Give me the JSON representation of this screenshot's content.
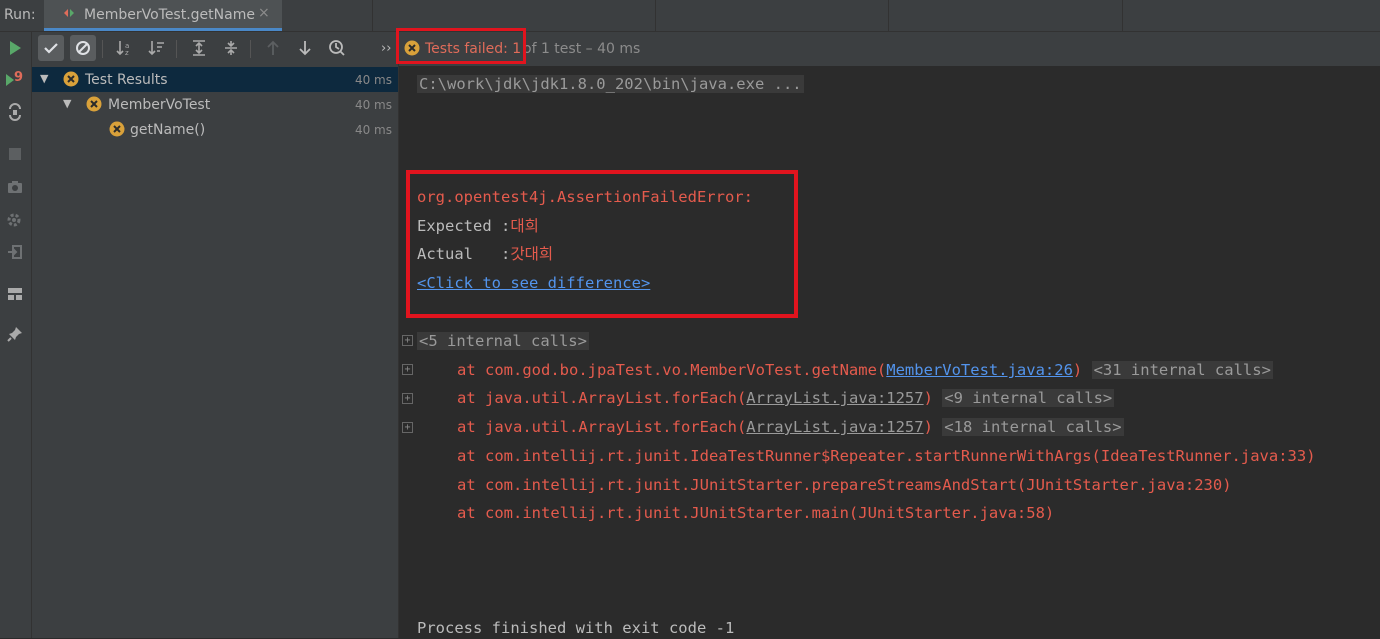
{
  "topbar": {
    "run_label": "Run:",
    "tab_title": "MemberVoTest.getName",
    "tab_close": "×"
  },
  "leftbar": {
    "icons": [
      "run-icon",
      "rerun-failed-icon",
      "toggle-auto-test-icon",
      "stop-icon",
      "camera-icon",
      "settings-icon",
      "exit-icon",
      "layout-icon",
      "pin-icon"
    ],
    "rerun_badge": "9"
  },
  "toolbar": {
    "icons": [
      "show-passed-icon",
      "show-ignored-icon",
      "sort-alpha-icon",
      "sort-duration-icon",
      "expand-all-icon",
      "collapse-all-icon",
      "previous-failed-icon",
      "next-failed-icon",
      "history-icon"
    ],
    "more": "››"
  },
  "tree": {
    "rows": [
      {
        "label": "Test Results",
        "time": "40 ms"
      },
      {
        "label": "MemberVoTest",
        "time": "40 ms"
      },
      {
        "label": "getName()",
        "time": "40 ms"
      }
    ]
  },
  "status": {
    "failed": "Tests failed: 1",
    "rest": "of 1 test – 40 ms"
  },
  "console": {
    "command": "C:\\work\\jdk\\jdk1.8.0_202\\bin\\java.exe ...",
    "error_class": "org.opentest4j.AssertionFailedError:",
    "expected_label": "Expected :",
    "expected_value": "대희",
    "actual_label": "Actual   :",
    "actual_value": "갓대희",
    "diff_link": "<Click to see difference>",
    "internal_5": "<5 internal calls>",
    "trace": [
      {
        "prefix": "at com.god.bo.jpaTest.vo.MemberVoTest.getName(",
        "link": "MemberVoTest.java:26",
        "suffix": ")",
        "internal": "<31 internal calls>"
      },
      {
        "prefix": "at java.util.ArrayList.forEach(",
        "link": "ArrayList.java:1257",
        "suffix": ")",
        "internal": "<9 internal calls>"
      },
      {
        "prefix": "at java.util.ArrayList.forEach(",
        "link": "ArrayList.java:1257",
        "suffix": ")",
        "internal": "<18 internal calls>"
      },
      {
        "text": "at com.intellij.rt.junit.IdeaTestRunner$Repeater.startRunnerWithArgs(IdeaTestRunner.java:33)"
      },
      {
        "text": "at com.intellij.rt.junit.JUnitStarter.prepareStreamsAndStart(JUnitStarter.java:230)"
      },
      {
        "text": "at com.intellij.rt.junit.JUnitStarter.main(JUnitStarter.java:58)"
      }
    ],
    "exit": "Process finished with exit code -1"
  },
  "colors": {
    "error": "#e55b4d",
    "link": "#5394ec",
    "highlight": "#e1141e",
    "fail_icon": "#d9a13a"
  }
}
